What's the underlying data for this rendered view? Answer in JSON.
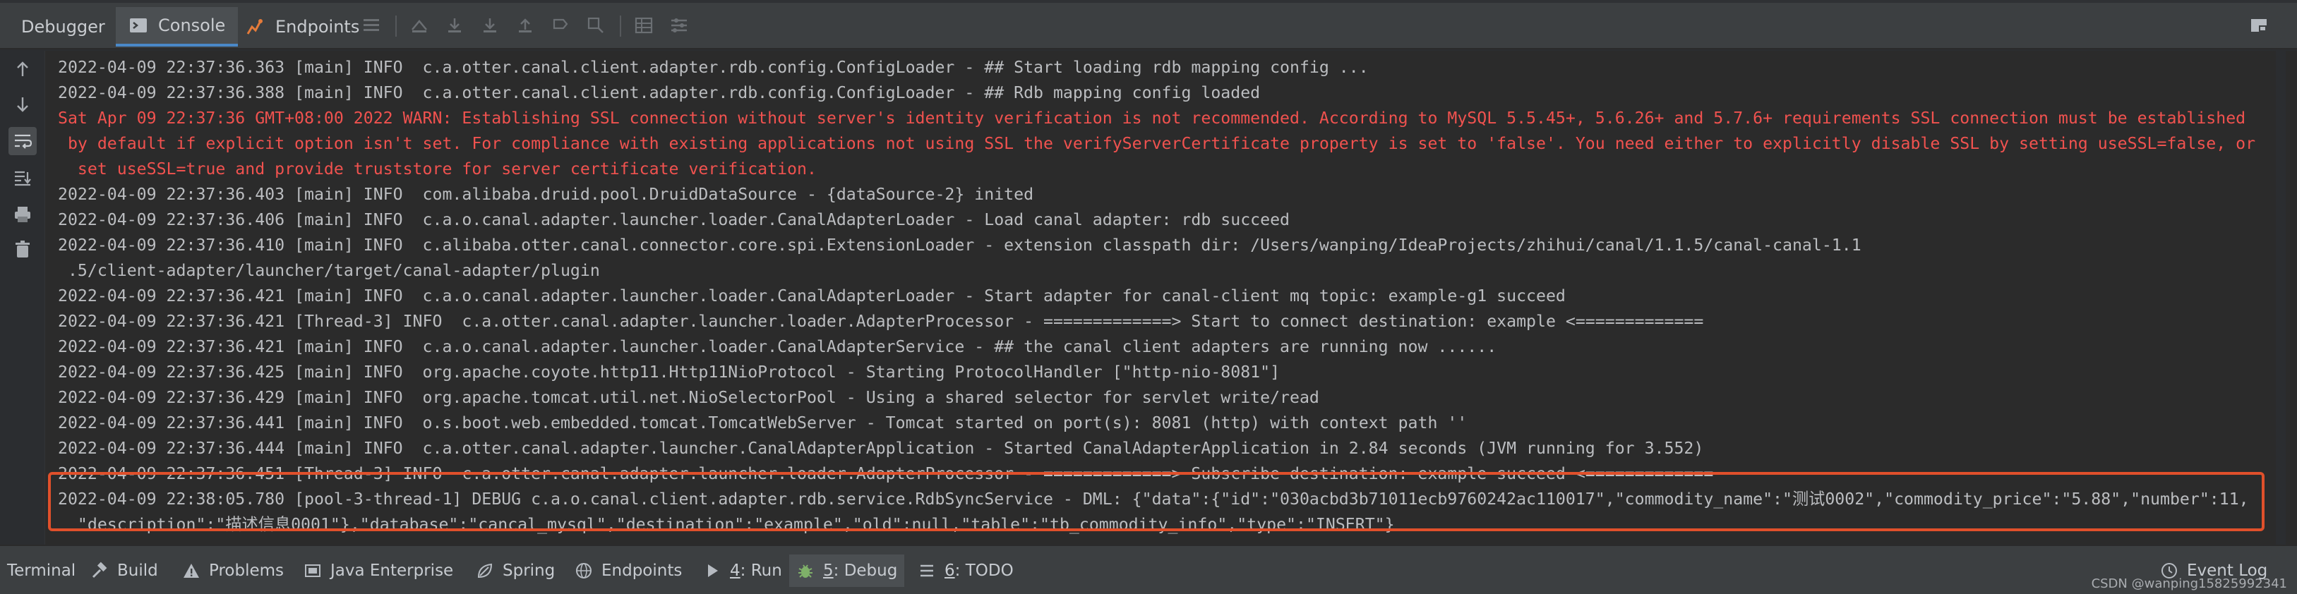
{
  "toolbar": {
    "tabs": [
      {
        "label": "Debugger"
      },
      {
        "label": "Console"
      },
      {
        "label": "Endpoints"
      }
    ]
  },
  "console": {
    "lines": [
      {
        "text": "2022-04-09 22:37:36.363 [main] INFO  c.a.otter.canal.client.adapter.rdb.config.ConfigLoader - ## Start loading rdb mapping config ..."
      },
      {
        "text": "2022-04-09 22:37:36.388 [main] INFO  c.a.otter.canal.client.adapter.rdb.config.ConfigLoader - ## Rdb mapping config loaded"
      },
      {
        "text": "Sat Apr 09 22:37:36 GMT+08:00 2022 WARN: Establishing SSL connection without server's identity verification is not recommended. According to MySQL 5.5.45+, 5.6.26+ and 5.7.6+ requirements SSL connection must be established"
      },
      {
        "text": " by default if explicit option isn't set. For compliance with existing applications not using SSL the verifyServerCertificate property is set to 'false'. You need either to explicitly disable SSL by setting useSSL=false, or"
      },
      {
        "text": "  set useSSL=true and provide truststore for server certificate verification."
      },
      {
        "text": "2022-04-09 22:37:36.403 [main] INFO  com.alibaba.druid.pool.DruidDataSource - {dataSource-2} inited"
      },
      {
        "text": "2022-04-09 22:37:36.406 [main] INFO  c.a.o.canal.adapter.launcher.loader.CanalAdapterLoader - Load canal adapter: rdb succeed"
      },
      {
        "text": "2022-04-09 22:37:36.410 [main] INFO  c.alibaba.otter.canal.connector.core.spi.ExtensionLoader - extension classpath dir: /Users/wanping/IdeaProjects/zhihui/canal/1.1.5/canal-canal-1.1"
      },
      {
        "text": " .5/client-adapter/launcher/target/canal-adapter/plugin"
      },
      {
        "text": "2022-04-09 22:37:36.421 [main] INFO  c.a.o.canal.adapter.launcher.loader.CanalAdapterLoader - Start adapter for canal-client mq topic: example-g1 succeed"
      },
      {
        "text": "2022-04-09 22:37:36.421 [Thread-3] INFO  c.a.otter.canal.adapter.launcher.loader.AdapterProcessor - =============> Start to connect destination: example <============="
      },
      {
        "text": "2022-04-09 22:37:36.421 [main] INFO  c.a.o.canal.adapter.launcher.loader.CanalAdapterService - ## the canal client adapters are running now ......"
      },
      {
        "text": "2022-04-09 22:37:36.425 [main] INFO  org.apache.coyote.http11.Http11NioProtocol - Starting ProtocolHandler [\"http-nio-8081\"]"
      },
      {
        "text": "2022-04-09 22:37:36.429 [main] INFO  org.apache.tomcat.util.net.NioSelectorPool - Using a shared selector for servlet write/read"
      },
      {
        "text": "2022-04-09 22:37:36.441 [main] INFO  o.s.boot.web.embedded.tomcat.TomcatWebServer - Tomcat started on port(s): 8081 (http) with context path ''"
      },
      {
        "text": "2022-04-09 22:37:36.444 [main] INFO  c.a.otter.canal.adapter.launcher.CanalAdapterApplication - Started CanalAdapterApplication in 2.84 seconds (JVM running for 3.552)"
      },
      {
        "text": "2022-04-09 22:37:36.451 [Thread-3] INFO  c.a.otter.canal.adapter.launcher.loader.AdapterProcessor - =============> Subscribe destination: example succeed <============="
      },
      {
        "text": "2022-04-09 22:38:05.780 [pool-3-thread-1] DEBUG c.a.o.canal.client.adapter.rdb.service.RdbSyncService - DML: {\"data\":{\"id\":\"030acbd3b71011ecb9760242ac110017\",\"commodity_name\":\"测试0002\",\"commodity_price\":\"5.88\",\"number\":11,"
      },
      {
        "text": "  \"description\":\"描述信息0001\"},\"database\":\"cancal_mysql\",\"destination\":\"example\",\"old\":null,\"table\":\"tb_commodity_info\",\"type\":\"INSERT\"}"
      }
    ]
  },
  "bottombar": {
    "tabs": [
      {
        "label": "Terminal"
      },
      {
        "label": "Build"
      },
      {
        "label": "Problems"
      },
      {
        "label": "Java Enterprise"
      },
      {
        "label": "Spring"
      },
      {
        "label": "Endpoints"
      },
      {
        "num": "4",
        "label": ": Run"
      },
      {
        "num": "5",
        "label": ": Debug"
      },
      {
        "num": "6",
        "label": ": TODO"
      },
      {
        "label": "Event Log"
      }
    ],
    "watermark": "CSDN @wanping15825992341"
  },
  "colors": {
    "accent": "#4a88c7",
    "warn_text": "#f0524f",
    "highlight_border": "#e0502b",
    "console_bg": "#2b2b2b"
  }
}
